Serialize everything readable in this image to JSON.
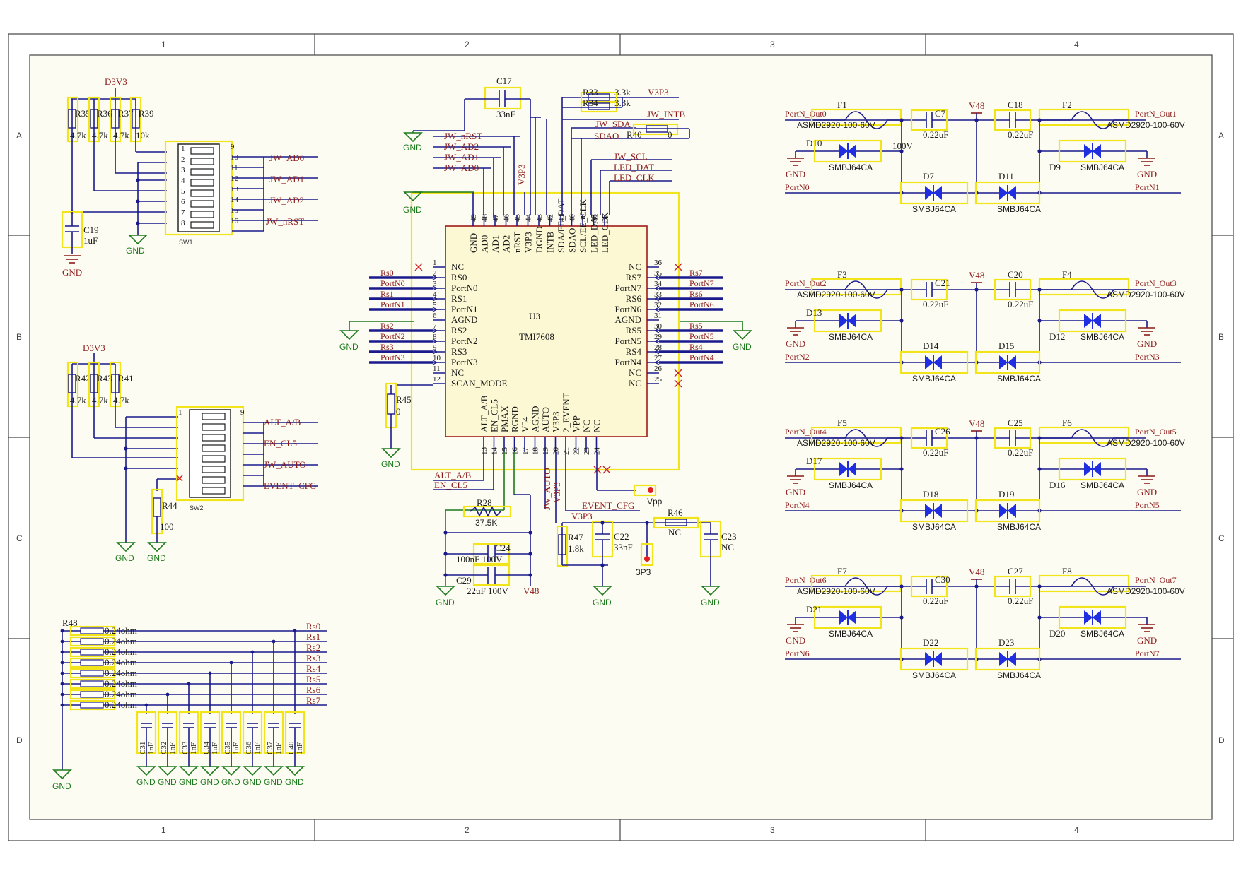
{
  "frame": {
    "cols": [
      "1",
      "2",
      "3",
      "4"
    ],
    "rows": [
      "A",
      "B",
      "C",
      "D"
    ]
  },
  "power": {
    "d3v3": "D3V3",
    "gnd": "GND",
    "v3p3": "V3P3",
    "v48": "V48",
    "vpp": "Vpp",
    "p3p3": "3P3"
  },
  "switch1": {
    "ref": "SW1",
    "resistors": [
      {
        "ref": "R35",
        "val": "4.7k"
      },
      {
        "ref": "R36",
        "val": "4.7k"
      },
      {
        "ref": "R37",
        "val": "4.7k"
      },
      {
        "ref": "R39",
        "val": "10k"
      }
    ],
    "cap": {
      "ref": "C19",
      "val": "1uF"
    },
    "pins_right": [
      "9",
      "10",
      "11",
      "12",
      "13",
      "14",
      "15",
      "16"
    ],
    "nets": [
      "JW_AD0",
      "JW_AD1",
      "JW_AD2",
      "JW_nRST"
    ],
    "labels": [
      "1",
      "2",
      "3",
      "4",
      "5",
      "6",
      "7",
      "8"
    ]
  },
  "switch2": {
    "ref": "SW2",
    "resistors": [
      {
        "ref": "R42",
        "val": "4.7k"
      },
      {
        "ref": "R43",
        "val": "4.7k"
      },
      {
        "ref": "R41",
        "val": "4.7k"
      }
    ],
    "r44": {
      "ref": "R44",
      "val": "100"
    },
    "nets": [
      "ALT_A/B",
      "EN_CL5",
      "JW_AUTO",
      "EVENT_CFG"
    ],
    "pin_first": "1",
    "pin_last": "9"
  },
  "rbank": {
    "ref": "R48",
    "val": "0.24ohm",
    "nets": [
      "Rs0",
      "Rs1",
      "Rs2",
      "Rs3",
      "Rs4",
      "Rs5",
      "Rs6",
      "Rs7"
    ],
    "caps": [
      "C31",
      "C32",
      "C33",
      "C34",
      "C35",
      "C36",
      "C37",
      "C40"
    ],
    "cap_val": "1nF"
  },
  "u3": {
    "ref": "U3",
    "part": "TMI7608",
    "top_pins": [
      "GND",
      "AD0",
      "AD1",
      "AD2",
      "nRST",
      "V3P3",
      "DGND",
      "INTB",
      "SDA/EE_DAT",
      "SDAO",
      "SCL/EE_CLK",
      "LED_DAT",
      "LED_CLK"
    ],
    "top_nums": [
      "49",
      "48",
      "47",
      "46",
      "45",
      "44",
      "43",
      "42",
      "41",
      "40",
      "39",
      "38",
      "37"
    ],
    "left_pins": [
      "NC",
      "RS0",
      "PortN0",
      "RS1",
      "PortN1",
      "AGND",
      "RS2",
      "PortN2",
      "RS3",
      "PortN3",
      "NC",
      "SCAN_MODE"
    ],
    "left_nums": [
      "1",
      "2",
      "3",
      "4",
      "5",
      "6",
      "7",
      "8",
      "9",
      "10",
      "11",
      "12"
    ],
    "right_pins": [
      "NC",
      "RS7",
      "PortN7",
      "RS6",
      "PortN6",
      "AGND",
      "RS5",
      "PortN5",
      "RS4",
      "PortN4",
      "NC",
      "NC"
    ],
    "right_nums": [
      "36",
      "35",
      "34",
      "33",
      "32",
      "31",
      "30",
      "29",
      "28",
      "27",
      "26",
      "25"
    ],
    "bottom_pins": [
      "ALT_A/B",
      "EN_CL5",
      "PMAX",
      "RGND",
      "V54",
      "AGND",
      "AUTO",
      "V3P3",
      "2_EVENT",
      "VPP",
      "NC",
      "NC"
    ],
    "bottom_nums": [
      "13",
      "14",
      "15",
      "16",
      "17",
      "18",
      "19",
      "20",
      "21",
      "22",
      "23",
      "24"
    ],
    "left_nets": [
      "Rs0",
      "PortN0",
      "Rs1",
      "PortN1",
      "Rs2",
      "PortN2",
      "Rs3",
      "PortN3"
    ],
    "right_nets": [
      "Rs7",
      "PortN7",
      "Rs6",
      "PortN6",
      "Rs5",
      "PortN5",
      "Rs4",
      "PortN4"
    ],
    "top_nets": [
      "JW_nRST",
      "JW_AD2",
      "JW_AD1",
      "JW_AD0",
      "V3P3"
    ],
    "top_right_nets": [
      "JW_INTB",
      "JW_SDA",
      "SDAO",
      "JW_SCL",
      "LED_DAT",
      "LED_CLK",
      "V3P3"
    ],
    "c17": {
      "ref": "C17",
      "val": "33nF"
    },
    "r33": {
      "ref": "R33",
      "val": "3.3k"
    },
    "r34": {
      "ref": "R34",
      "val": "3.3k"
    },
    "r40": {
      "ref": "R40",
      "val": "0"
    },
    "r45": {
      "ref": "R45",
      "val": "0"
    },
    "bottom_nets": [
      "ALT_A/B",
      "EN_CL5",
      "JW_AUTO",
      "V3P3",
      "EVENT_CFG"
    ],
    "r28": {
      "ref": "R28",
      "val": "37.5K"
    },
    "c24": {
      "ref": "C24",
      "val": "100nF 100V"
    },
    "c29": {
      "ref": "C29",
      "val": "22uF 100V"
    },
    "r47": {
      "ref": "R47",
      "val": "1.8k"
    },
    "c22": {
      "ref": "C22",
      "val": "33nF"
    },
    "r46": {
      "ref": "R46",
      "val": "NC"
    },
    "c23": {
      "ref": "C23",
      "val": "NC"
    }
  },
  "ports": [
    {
      "fl": "F1",
      "fr": "F2",
      "cl": "C7",
      "cr": "C18",
      "cv": "0.22uF",
      "cl_extra": "100V",
      "dl": "D10",
      "dr": "D9",
      "dbl": "D7",
      "dbr": "D11",
      "outl": "PortN_Out0",
      "outr": "PortN_Out1",
      "nl": "PortN0",
      "nr": "PortN1"
    },
    {
      "fl": "F3",
      "fr": "F4",
      "cl": "C21",
      "cr": "C20",
      "cv": "0.22uF",
      "cl_extra": "",
      "dl": "D13",
      "dr": "D12",
      "dbl": "D14",
      "dbr": "D15",
      "outl": "PortN_Out2",
      "outr": "PortN_Out3",
      "nl": "PortN2",
      "nr": "PortN3"
    },
    {
      "fl": "F5",
      "fr": "F6",
      "cl": "C26",
      "cr": "C25",
      "cv": "0.22uF",
      "cl_extra": "",
      "dl": "D17",
      "dr": "D16",
      "dbl": "D18",
      "dbr": "D19",
      "outl": "PortN_Out4",
      "outr": "PortN_Out5",
      "nl": "PortN4",
      "nr": "PortN5"
    },
    {
      "fl": "F7",
      "fr": "F8",
      "cl": "C30",
      "cr": "C27",
      "cv": "0.22uF",
      "cl_extra": "",
      "dl": "D21",
      "dr": "D20",
      "dbl": "D22",
      "dbr": "D23",
      "outl": "PortN_Out6",
      "outr": "PortN_Out7",
      "nl": "PortN6",
      "nr": "PortN7"
    }
  ],
  "fuse_part": "ASMD2920-100-60V",
  "tvs_part": "SMBJ64CA"
}
